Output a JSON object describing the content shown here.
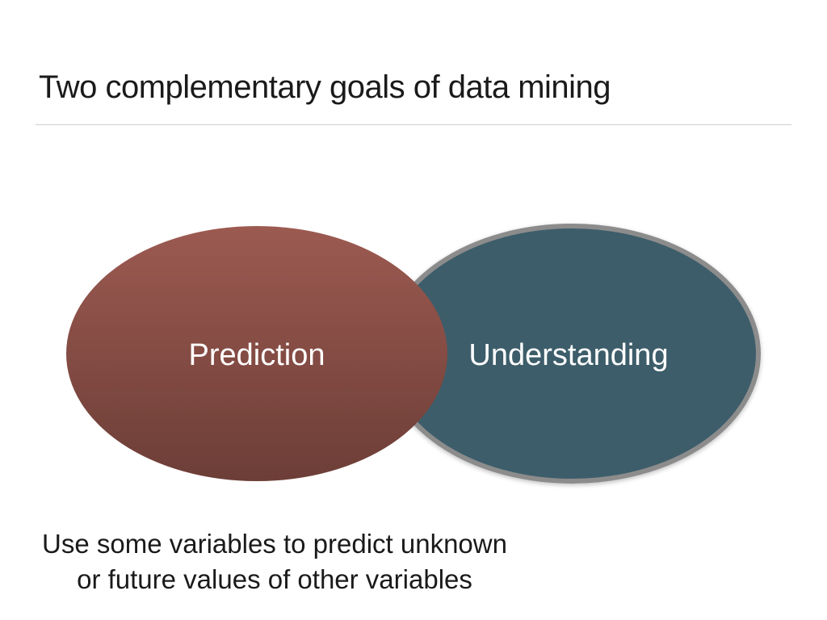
{
  "slide": {
    "title": "Two complementary goals of data mining"
  },
  "diagram": {
    "circles": [
      {
        "label": "Prediction",
        "fill_top": "#9c5a51",
        "fill_bottom": "#6c3e37"
      },
      {
        "label": "Understanding",
        "fill": "#3e5d6b",
        "stroke": "#8c8c8c"
      }
    ]
  },
  "caption": {
    "line1": "Use some variables to predict unknown",
    "line2": "or future values of other variables"
  }
}
